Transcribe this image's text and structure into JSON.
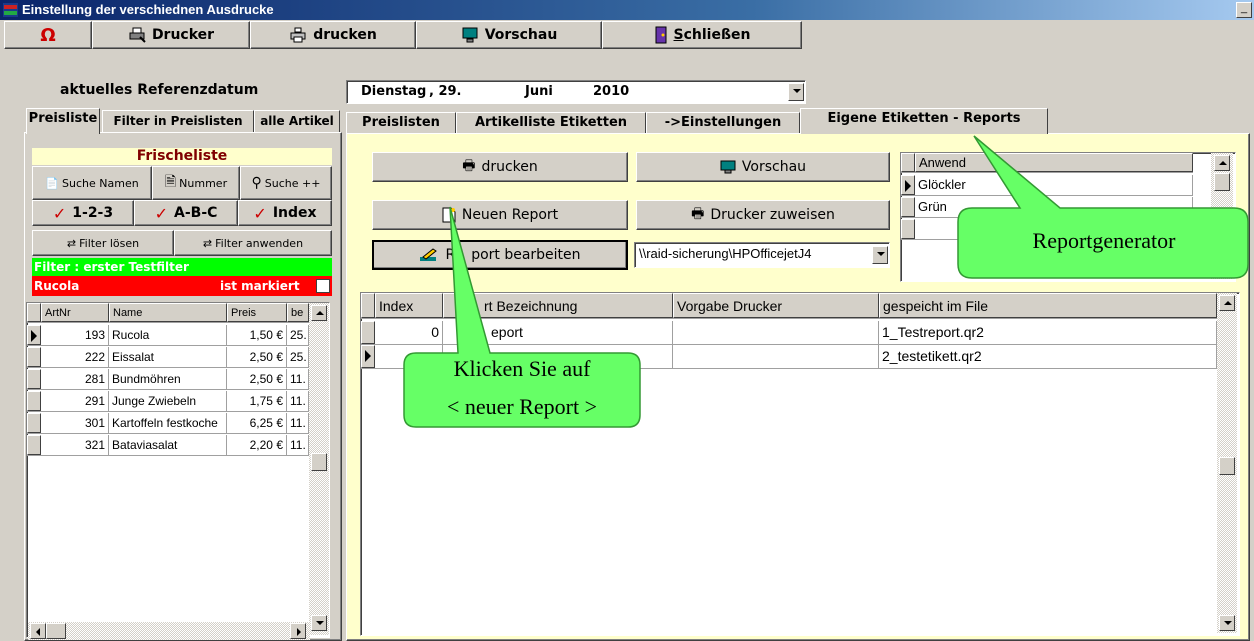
{
  "window": {
    "title": "Einstellung der verschiednen Ausdrucke",
    "minimize": "_"
  },
  "toolbar": {
    "drucker": "Drucker",
    "drucken": "drucken",
    "vorschau": "Vorschau",
    "schliessen_first": "S",
    "schliessen_rest": "chließen"
  },
  "reference": {
    "label": "aktuelles Referenzdatum",
    "weekday": "Dienstag",
    "day": ", 29.",
    "month": "Juni",
    "year": "2010"
  },
  "left_tabs": [
    "Preisliste",
    "Filter in Preislisten",
    "alle Artikel"
  ],
  "left_panel": {
    "header": "Frischeliste",
    "search_names": "Suche Namen",
    "search_number": "Nummer",
    "search_plus": "Suche ++",
    "sort_123": "1-2-3",
    "sort_abc": "A-B-C",
    "sort_index": "Index",
    "filter_clear": "Filter lösen",
    "filter_apply": "Filter anwenden",
    "filter_status": "Filter : erster Testfilter",
    "marked_item": "Rucola",
    "marked_label": "ist markiert"
  },
  "left_grid": {
    "columns": [
      "ArtNr",
      "Name",
      "Preis",
      "be"
    ],
    "rows": [
      {
        "artnr": "193",
        "name": "Rucola",
        "preis": "1,50 €",
        "be": "25."
      },
      {
        "artnr": "222",
        "name": "Eissalat",
        "preis": "2,50 €",
        "be": "25."
      },
      {
        "artnr": "281",
        "name": "Bundmöhren",
        "preis": "2,50 €",
        "be": "11."
      },
      {
        "artnr": "291",
        "name": "Junge Zwiebeln",
        "preis": "1,75 €",
        "be": "11."
      },
      {
        "artnr": "301",
        "name": "Kartoffeln festkoche",
        "preis": "6,25 €",
        "be": "11."
      },
      {
        "artnr": "321",
        "name": "Bataviasalat",
        "preis": "2,20 €",
        "be": "11."
      }
    ]
  },
  "right_tabs": [
    "Preislisten",
    "Artikelliste Etiketten",
    "->Einstellungen",
    "Eigene Etiketten - Reports"
  ],
  "right_panel": {
    "drucken": "drucken",
    "vorschau": "Vorschau",
    "neuer_report": "Neuen Report",
    "drucker_zuweisen": "Drucker zuweisen",
    "report_bearbeiten_a": "R",
    "report_bearbeiten_b": "port bearbeiten",
    "printer_path": "\\\\raid-sicherung\\HPOfficejetJ4"
  },
  "mini_grid": {
    "column": "Anwend",
    "rows": [
      "Glöckler",
      "Grün"
    ]
  },
  "reports_grid": {
    "columns": [
      "Index",
      "rt Bezeichnung",
      "Vorgabe Drucker",
      "gespeicht im File"
    ],
    "rows": [
      {
        "index": "0",
        "name": "eport",
        "printer": "",
        "file": "1_Testreport.qr2"
      },
      {
        "index": "",
        "name": "",
        "printer": "",
        "file": "2_testetikett.qr2"
      }
    ]
  },
  "callouts": {
    "reportgenerator": "Reportgenerator",
    "klicken_line1": "Klicken Sie auf",
    "klicken_line2": "< neuer Report >"
  },
  "colors": {
    "callout_green": "#66ff66",
    "filter_green": "#00ff00",
    "marked_red": "#ff0000",
    "panel_yellow": "#ffffcc"
  }
}
